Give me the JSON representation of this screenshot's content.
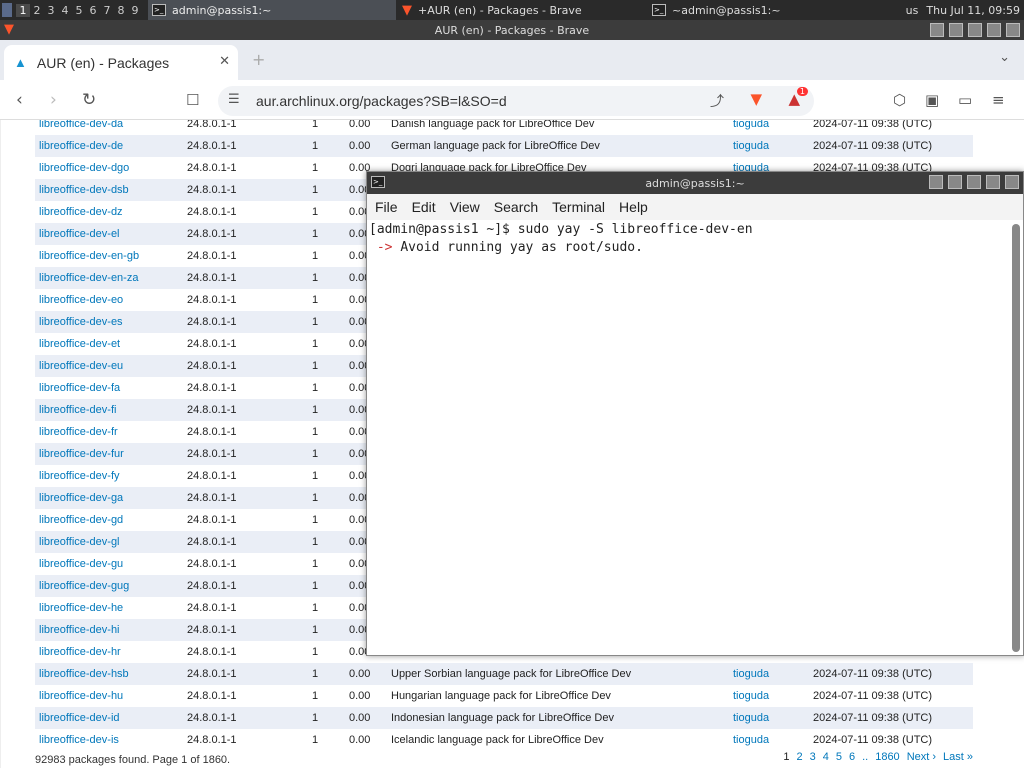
{
  "panel": {
    "workspaces": [
      "1",
      "2",
      "3",
      "4",
      "5",
      "6",
      "7",
      "8",
      "9"
    ],
    "tasks": [
      {
        "title": "admin@passis1:~"
      },
      {
        "title": "+AUR (en) - Packages - Brave"
      },
      {
        "title": "~admin@passis1:~"
      }
    ],
    "keyboard": "us",
    "clock": "Thu Jul 11, 09:59"
  },
  "browser": {
    "window_title": "AUR (en) - Packages - Brave",
    "tab_title": "AUR (en) - Packages",
    "url": "aur.archlinux.org/packages?SB=l&SO=d",
    "shield_badge": "1"
  },
  "packages": [
    {
      "name": "libreoffice-dev-da",
      "version": "24.8.0.1-1",
      "votes": "1",
      "popularity": "0.00",
      "description": "Danish language pack for LibreOffice Dev",
      "maintainer": "tioguda",
      "updated": "2024-07-11 09:38 (UTC)"
    },
    {
      "name": "libreoffice-dev-de",
      "version": "24.8.0.1-1",
      "votes": "1",
      "popularity": "0.00",
      "description": "German language pack for LibreOffice Dev",
      "maintainer": "tioguda",
      "updated": "2024-07-11 09:38 (UTC)"
    },
    {
      "name": "libreoffice-dev-dgo",
      "version": "24.8.0.1-1",
      "votes": "1",
      "popularity": "0.00",
      "description": "Dogri language pack for LibreOffice Dev",
      "maintainer": "tioguda",
      "updated": "2024-07-11 09:38 (UTC)"
    },
    {
      "name": "libreoffice-dev-dsb",
      "version": "24.8.0.1-1",
      "votes": "1",
      "popularity": "0.00",
      "description": "",
      "maintainer": "",
      "updated": ""
    },
    {
      "name": "libreoffice-dev-dz",
      "version": "24.8.0.1-1",
      "votes": "1",
      "popularity": "0.00",
      "description": "",
      "maintainer": "",
      "updated": ""
    },
    {
      "name": "libreoffice-dev-el",
      "version": "24.8.0.1-1",
      "votes": "1",
      "popularity": "0.00",
      "description": "",
      "maintainer": "",
      "updated": ""
    },
    {
      "name": "libreoffice-dev-en-gb",
      "version": "24.8.0.1-1",
      "votes": "1",
      "popularity": "0.00",
      "description": "",
      "maintainer": "",
      "updated": ""
    },
    {
      "name": "libreoffice-dev-en-za",
      "version": "24.8.0.1-1",
      "votes": "1",
      "popularity": "0.00",
      "description": "",
      "maintainer": "",
      "updated": ""
    },
    {
      "name": "libreoffice-dev-eo",
      "version": "24.8.0.1-1",
      "votes": "1",
      "popularity": "0.00",
      "description": "",
      "maintainer": "",
      "updated": ""
    },
    {
      "name": "libreoffice-dev-es",
      "version": "24.8.0.1-1",
      "votes": "1",
      "popularity": "0.00",
      "description": "",
      "maintainer": "",
      "updated": ""
    },
    {
      "name": "libreoffice-dev-et",
      "version": "24.8.0.1-1",
      "votes": "1",
      "popularity": "0.00",
      "description": "",
      "maintainer": "",
      "updated": ""
    },
    {
      "name": "libreoffice-dev-eu",
      "version": "24.8.0.1-1",
      "votes": "1",
      "popularity": "0.00",
      "description": "",
      "maintainer": "",
      "updated": ""
    },
    {
      "name": "libreoffice-dev-fa",
      "version": "24.8.0.1-1",
      "votes": "1",
      "popularity": "0.00",
      "description": "",
      "maintainer": "",
      "updated": ""
    },
    {
      "name": "libreoffice-dev-fi",
      "version": "24.8.0.1-1",
      "votes": "1",
      "popularity": "0.00",
      "description": "",
      "maintainer": "",
      "updated": ""
    },
    {
      "name": "libreoffice-dev-fr",
      "version": "24.8.0.1-1",
      "votes": "1",
      "popularity": "0.00",
      "description": "",
      "maintainer": "",
      "updated": ""
    },
    {
      "name": "libreoffice-dev-fur",
      "version": "24.8.0.1-1",
      "votes": "1",
      "popularity": "0.00",
      "description": "",
      "maintainer": "",
      "updated": ""
    },
    {
      "name": "libreoffice-dev-fy",
      "version": "24.8.0.1-1",
      "votes": "1",
      "popularity": "0.00",
      "description": "",
      "maintainer": "",
      "updated": ""
    },
    {
      "name": "libreoffice-dev-ga",
      "version": "24.8.0.1-1",
      "votes": "1",
      "popularity": "0.00",
      "description": "",
      "maintainer": "",
      "updated": ""
    },
    {
      "name": "libreoffice-dev-gd",
      "version": "24.8.0.1-1",
      "votes": "1",
      "popularity": "0.00",
      "description": "",
      "maintainer": "",
      "updated": ""
    },
    {
      "name": "libreoffice-dev-gl",
      "version": "24.8.0.1-1",
      "votes": "1",
      "popularity": "0.00",
      "description": "",
      "maintainer": "",
      "updated": ""
    },
    {
      "name": "libreoffice-dev-gu",
      "version": "24.8.0.1-1",
      "votes": "1",
      "popularity": "0.00",
      "description": "",
      "maintainer": "",
      "updated": ""
    },
    {
      "name": "libreoffice-dev-gug",
      "version": "24.8.0.1-1",
      "votes": "1",
      "popularity": "0.00",
      "description": "",
      "maintainer": "",
      "updated": ""
    },
    {
      "name": "libreoffice-dev-he",
      "version": "24.8.0.1-1",
      "votes": "1",
      "popularity": "0.00",
      "description": "",
      "maintainer": "",
      "updated": ""
    },
    {
      "name": "libreoffice-dev-hi",
      "version": "24.8.0.1-1",
      "votes": "1",
      "popularity": "0.00",
      "description": "",
      "maintainer": "",
      "updated": ""
    },
    {
      "name": "libreoffice-dev-hr",
      "version": "24.8.0.1-1",
      "votes": "1",
      "popularity": "0.00",
      "description": "",
      "maintainer": "",
      "updated": ""
    },
    {
      "name": "libreoffice-dev-hsb",
      "version": "24.8.0.1-1",
      "votes": "1",
      "popularity": "0.00",
      "description": "Upper Sorbian language pack for LibreOffice Dev",
      "maintainer": "tioguda",
      "updated": "2024-07-11 09:38 (UTC)"
    },
    {
      "name": "libreoffice-dev-hu",
      "version": "24.8.0.1-1",
      "votes": "1",
      "popularity": "0.00",
      "description": "Hungarian language pack for LibreOffice Dev",
      "maintainer": "tioguda",
      "updated": "2024-07-11 09:38 (UTC)"
    },
    {
      "name": "libreoffice-dev-id",
      "version": "24.8.0.1-1",
      "votes": "1",
      "popularity": "0.00",
      "description": "Indonesian language pack for LibreOffice Dev",
      "maintainer": "tioguda",
      "updated": "2024-07-11 09:38 (UTC)"
    },
    {
      "name": "libreoffice-dev-is",
      "version": "24.8.0.1-1",
      "votes": "1",
      "popularity": "0.00",
      "description": "Icelandic language pack for LibreOffice Dev",
      "maintainer": "tioguda",
      "updated": "2024-07-11 09:38 (UTC)"
    }
  ],
  "footer": {
    "summary": "92983 packages found. Page 1 of 1860.",
    "pages": [
      "1",
      "2",
      "3",
      "4",
      "5",
      "6",
      "..",
      "1860",
      "Next ›",
      "Last »"
    ]
  },
  "terminal": {
    "title": "admin@passis1:~",
    "menu": [
      "File",
      "Edit",
      "View",
      "Search",
      "Terminal",
      "Help"
    ],
    "lines": [
      {
        "prompt": "[admin@passis1 ~]$ ",
        "text": "sudo yay -S libreoffice-dev-en"
      },
      {
        "prompt": " -> ",
        "text": "Avoid running yay as root/sudo."
      }
    ]
  }
}
